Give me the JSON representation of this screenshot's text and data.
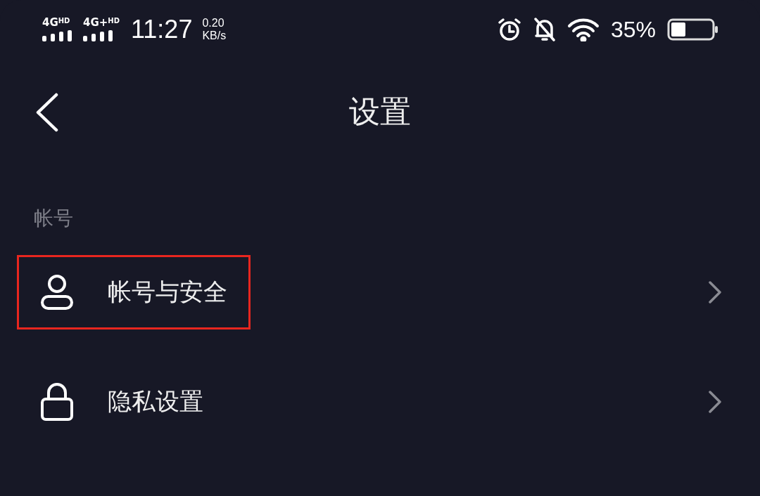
{
  "status_bar": {
    "signals": [
      {
        "label": "4G",
        "tag": "HD"
      },
      {
        "label": "4G+",
        "tag": "HD"
      }
    ],
    "time": "11:27",
    "speed": {
      "value": "0.20",
      "unit": "KB/s"
    },
    "battery": "35%"
  },
  "header": {
    "title": "设置"
  },
  "sections": [
    {
      "title": "帐号",
      "items": [
        {
          "kind": "person",
          "label": "帐号与安全",
          "highlighted": true
        },
        {
          "kind": "lock",
          "label": "隐私设置",
          "highlighted": false
        }
      ]
    }
  ]
}
